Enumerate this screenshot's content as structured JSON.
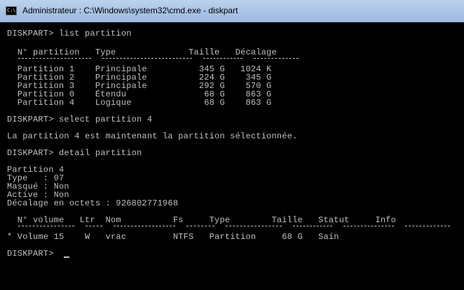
{
  "window": {
    "title": "Administrateur : C:\\Windows\\system32\\cmd.exe - diskpart",
    "icon_text": "C:\\",
    "icon": "console-icon"
  },
  "console": {
    "colors": {
      "background": "#000000",
      "text": "#c0c0c0"
    },
    "lines": [
      "DISKPART> list partition",
      "  N° partition   Type              Taille   Décalage",
      "  Partition 1    Principale          345 G   1024 K",
      "  Partition 2    Principale          224 G    345 G",
      "  Partition 3    Principale          292 G    570 G",
      "  Partition 0    Étendu               68 G    863 G",
      "  Partition 4    Logique              68 G    863 G",
      "DISKPART> select partition 4",
      "La partition 4 est maintenant la partition sélectionnée.",
      "DISKPART> detail partition",
      "Partition 4",
      "Type   : 07",
      "Masqué : Non",
      "Active : Non",
      "Décalage en octets : 926802771968",
      "  N° volume   Ltr  Nom          Fs     Type        Taille   Statut     Info",
      "* Volume 15    W   vrac         NTFS   Partition     68 G   Sain",
      "DISKPART> "
    ]
  }
}
